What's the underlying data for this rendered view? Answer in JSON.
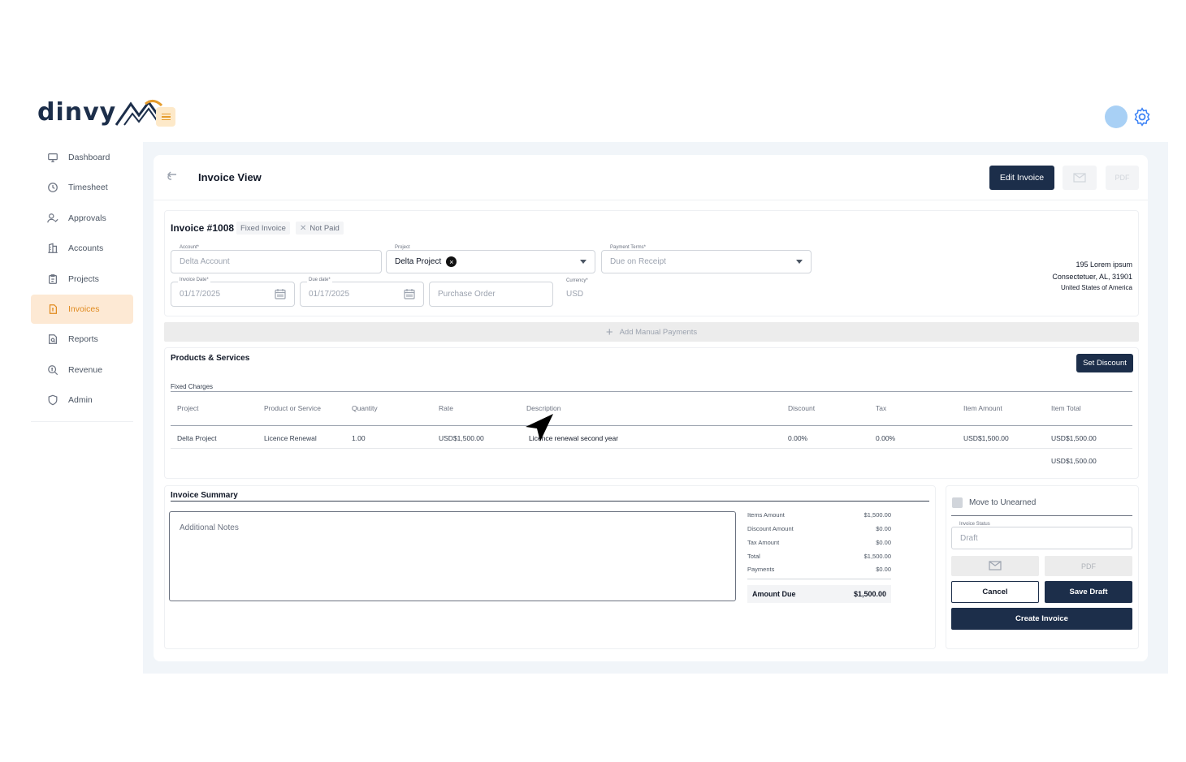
{
  "brand": {
    "name": "dinvy"
  },
  "sidebar": {
    "items": [
      {
        "label": "Dashboard",
        "icon": "monitor-icon"
      },
      {
        "label": "Timesheet",
        "icon": "clock-icon"
      },
      {
        "label": "Approvals",
        "icon": "user-check-icon"
      },
      {
        "label": "Accounts",
        "icon": "building-icon"
      },
      {
        "label": "Projects",
        "icon": "clipboard-icon"
      },
      {
        "label": "Invoices",
        "icon": "invoice-icon",
        "active": true
      },
      {
        "label": "Reports",
        "icon": "report-icon"
      },
      {
        "label": "Revenue",
        "icon": "search-money-icon"
      },
      {
        "label": "Admin",
        "icon": "shield-icon"
      }
    ]
  },
  "header": {
    "title": "Invoice View",
    "edit_label": "Edit Invoice",
    "pdf_label": "PDF"
  },
  "invoice": {
    "number": "Invoice #1008",
    "type_tag": "Fixed Invoice",
    "status_tag": "Not Paid",
    "account": {
      "label": "Account*",
      "value": "Delta Account"
    },
    "project": {
      "label": "Project",
      "value": "Delta Project"
    },
    "payment_terms": {
      "label": "Payment Terms*",
      "value": "Due on Receipt"
    },
    "invoice_date": {
      "label": "Invoice Date*",
      "value": "01/17/2025"
    },
    "due_date": {
      "label": "Due date*",
      "value": "01/17/2025"
    },
    "purchase_order": {
      "placeholder": "Purchase Order"
    },
    "currency": {
      "label": "Currency*",
      "value": "USD"
    },
    "address": [
      "195 Lorem ipsum",
      "Consectetuer, AL, 31901",
      "United States of America"
    ],
    "manual_payments_label": "Add Manual Payments"
  },
  "products": {
    "title": "Products & Services",
    "discount_label": "Set Discount",
    "section": "Fixed Charges",
    "columns": [
      "Project",
      "Product or Service",
      "Quantity",
      "Rate",
      "Description",
      "Discount",
      "Tax",
      "Item Amount",
      "Item Total"
    ],
    "rows": [
      [
        "Delta Project",
        "Licence Renewal",
        "1.00",
        "USD$1,500.00",
        "Licence renewal second year",
        "0.00%",
        "0.00%",
        "USD$1,500.00",
        "USD$1,500.00"
      ]
    ],
    "total": "USD$1,500.00"
  },
  "summary": {
    "title": "Invoice Summary",
    "notes_placeholder": "Additional Notes",
    "lines": [
      {
        "label": "Items Amount",
        "value": "$1,500.00"
      },
      {
        "label": "Discount Amount",
        "value": "$0.00"
      },
      {
        "label": "Tax Amount",
        "value": "$0.00"
      },
      {
        "label": "Total",
        "value": "$1,500.00"
      },
      {
        "label": "Payments",
        "value": "$0.00"
      }
    ],
    "amount_due_label": "Amount Due",
    "amount_due_value": "$1,500.00"
  },
  "status_panel": {
    "move_label": "Move to Unearned",
    "status_label": "Invoice Status",
    "status_value": "Draft",
    "pdf_label": "PDF",
    "cancel_label": "Cancel",
    "save_label": "Save Draft",
    "create_label": "Create Invoice"
  },
  "colors": {
    "primary": "#1c2e4a",
    "accent": "#e08a1e",
    "active_bg": "#fde9d4"
  }
}
